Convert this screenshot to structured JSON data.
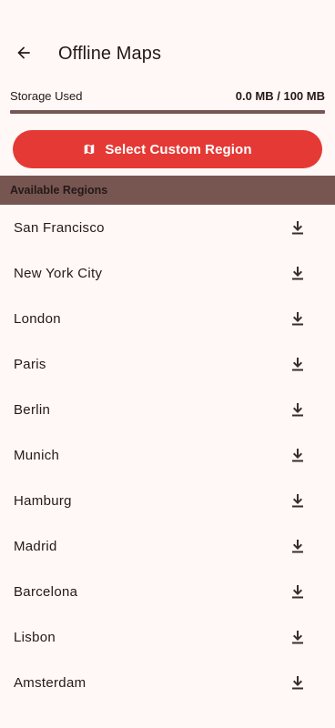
{
  "header": {
    "title": "Offline Maps",
    "back_icon": "arrow-back-icon"
  },
  "storage": {
    "label": "Storage Used",
    "value": "0.0 MB / 100 MB",
    "used_fraction": 0.0
  },
  "custom_region_button": {
    "label": "Select Custom Region",
    "icon": "map-icon"
  },
  "section": {
    "title": "Available Regions"
  },
  "regions": [
    {
      "name": "San Francisco",
      "icon": "download-icon"
    },
    {
      "name": "New York City",
      "icon": "download-icon"
    },
    {
      "name": "London",
      "icon": "download-icon"
    },
    {
      "name": "Paris",
      "icon": "download-icon"
    },
    {
      "name": "Berlin",
      "icon": "download-icon"
    },
    {
      "name": "Munich",
      "icon": "download-icon"
    },
    {
      "name": "Hamburg",
      "icon": "download-icon"
    },
    {
      "name": "Madrid",
      "icon": "download-icon"
    },
    {
      "name": "Barcelona",
      "icon": "download-icon"
    },
    {
      "name": "Lisbon",
      "icon": "download-icon"
    },
    {
      "name": "Amsterdam",
      "icon": "download-icon"
    }
  ],
  "colors": {
    "background": "#fff8f6",
    "accent": "#e53935",
    "section_bg": "#775651",
    "text": "#231918"
  }
}
